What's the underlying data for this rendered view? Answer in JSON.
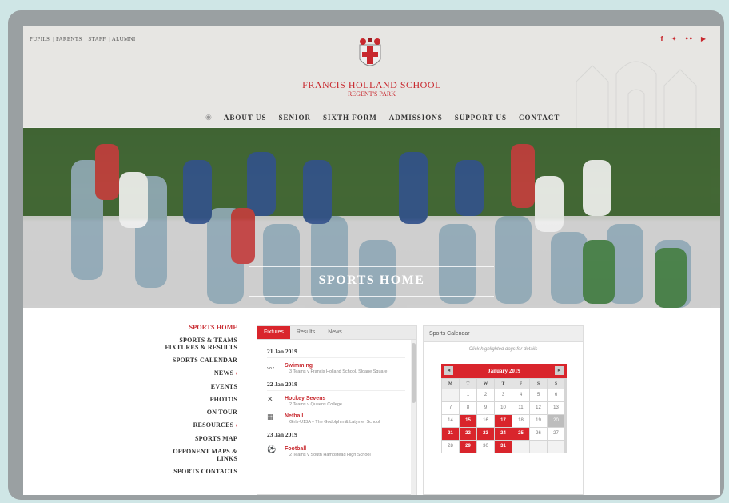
{
  "header": {
    "top_links": [
      "PUPILS",
      "PARENTS",
      "STAFF",
      "ALUMNI"
    ],
    "social_icons": [
      "facebook-icon",
      "twitter-icon",
      "flickr-icon",
      "youtube-icon"
    ],
    "school_name": "FRANCIS HOLLAND SCHOOL",
    "school_sub": "REGENT'S PARK",
    "nav": [
      "ABOUT US",
      "SENIOR",
      "SIXTH FORM",
      "ADMISSIONS",
      "SUPPORT US",
      "CONTACT"
    ]
  },
  "hero": {
    "title": "SPORTS HOME"
  },
  "sidebar": {
    "items": [
      {
        "label": "SPORTS HOME",
        "active": true
      },
      {
        "label": "SPORTS & TEAMS FIXTURES & RESULTS"
      },
      {
        "label": "SPORTS CALENDAR"
      },
      {
        "label": "NEWS",
        "arrow": "›"
      },
      {
        "label": "EVENTS"
      },
      {
        "label": "PHOTOS"
      },
      {
        "label": "ON TOUR"
      },
      {
        "label": "RESOURCES",
        "arrow": "›"
      },
      {
        "label": "SPORTS MAP"
      },
      {
        "label": "OPPONENT MAPS & LINKS"
      },
      {
        "label": "SPORTS CONTACTS"
      }
    ]
  },
  "fixtures": {
    "tabs": [
      "Fixtures",
      "Results",
      "News"
    ],
    "days": [
      {
        "date": "21 Jan 2019",
        "items": [
          {
            "name": "Swimming",
            "desc": "3 Teams v Francis Holland School, Sloane Square"
          }
        ]
      },
      {
        "date": "22 Jan 2019",
        "items": [
          {
            "name": "Hockey Sevens",
            "desc": "2 Teams v Queens College"
          },
          {
            "name": "Netball",
            "desc": "Girls-U13A v The Godolphin & Latymer School"
          }
        ]
      },
      {
        "date": "23 Jan 2019",
        "items": [
          {
            "name": "Football",
            "desc": "2 Teams v South Hampstead High School"
          }
        ]
      }
    ]
  },
  "calendar": {
    "heading": "Sports Calendar",
    "hint": "Click highlighted days for details",
    "month": "January 2019",
    "dow": [
      "M",
      "T",
      "W",
      "T",
      "F",
      "S",
      "S"
    ],
    "weeks": [
      [
        "",
        "1",
        "2",
        "3",
        "4",
        "5",
        "6"
      ],
      [
        "7",
        "8",
        "9",
        "10",
        "11",
        "12",
        "13"
      ],
      [
        "14",
        "15",
        "16",
        "17",
        "18",
        "19",
        "20"
      ],
      [
        "21",
        "22",
        "23",
        "24",
        "25",
        "26",
        "27"
      ],
      [
        "28",
        "29",
        "30",
        "31",
        "",
        "",
        ""
      ]
    ],
    "highlighted": [
      "15",
      "17",
      "21",
      "22",
      "23",
      "24",
      "25",
      "29",
      "31"
    ],
    "today": "20"
  }
}
